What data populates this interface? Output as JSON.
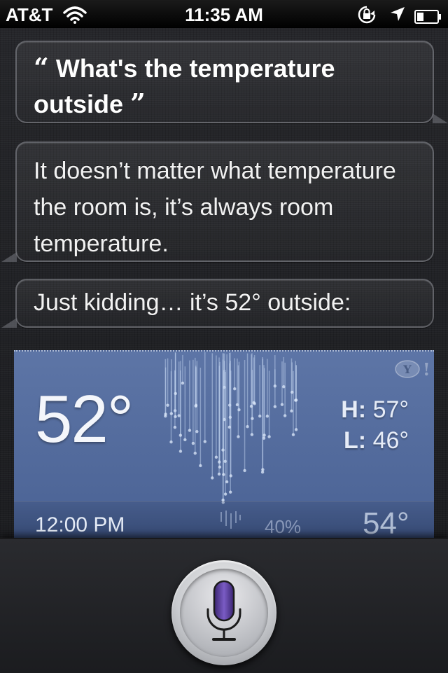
{
  "status_bar": {
    "carrier": "AT&T",
    "time": "11:35 AM",
    "icons": [
      "wifi-icon",
      "rotation-lock-icon",
      "location-icon",
      "battery-icon"
    ]
  },
  "user_query": {
    "open_quote": "“",
    "text": "What's the temperature outside",
    "close_quote": "”"
  },
  "siri_responses": [
    "It doesn’t matter what temperature the room is, it’s always room temperature.",
    "Just kidding… it’s 52° outside:"
  ],
  "weather": {
    "current_temp": "52°",
    "high_label": "H:",
    "high_value": "57°",
    "low_label": "L:",
    "low_value": "46°",
    "provider_icon": "yahoo-logo-icon",
    "condition_icon": "rain-icon",
    "hourly": {
      "time": "12:00 PM",
      "precip": "40%",
      "temp": "54°"
    }
  },
  "mic_button": {
    "icon": "microphone-icon"
  },
  "colors": {
    "card_blue": "#5470a0",
    "mic_purple": "#5a3e9a",
    "background": "#1f2023"
  }
}
